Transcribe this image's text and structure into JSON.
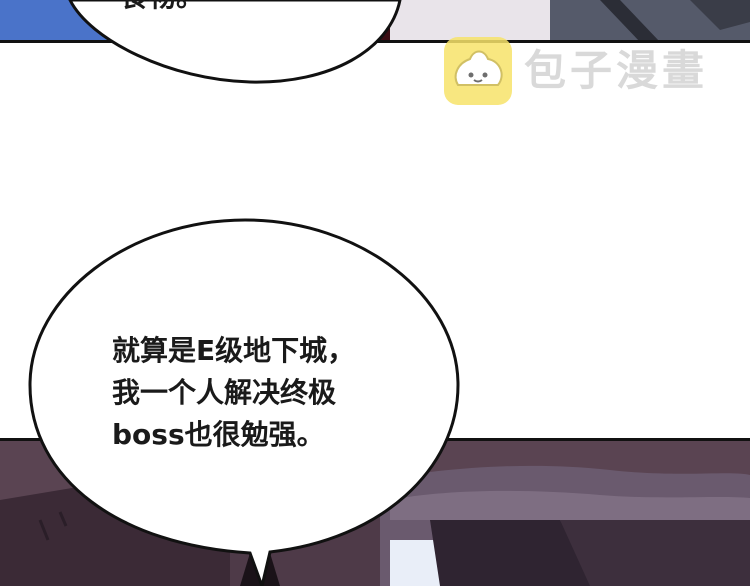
{
  "panels": {
    "top": {
      "background_color": "#4a73c9",
      "bubble_text": "食物。"
    },
    "middle": {
      "background_color": "#ffffff"
    },
    "bottom": {
      "background_color": "#4e3a48"
    }
  },
  "watermark": {
    "text": "包子漫畫",
    "badge_color": "#f7e36a"
  },
  "speech_bubble": {
    "lines": [
      "就算是E级地下城，",
      "我一个人解决终极",
      "boss也很勉强。"
    ]
  }
}
